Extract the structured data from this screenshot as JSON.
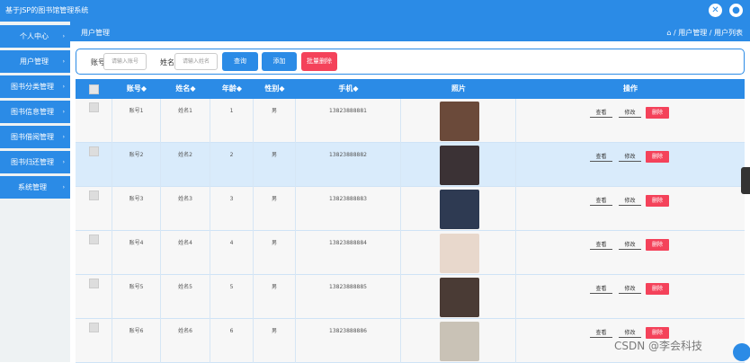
{
  "app": {
    "title": "基于JSP的图书馆管理系统",
    "header_icons": [
      "close-circle-icon",
      "user-icon"
    ]
  },
  "sidebar": {
    "items": [
      {
        "label": "个人中心"
      },
      {
        "label": "用户管理"
      },
      {
        "label": "图书分类管理"
      },
      {
        "label": "图书信息管理"
      },
      {
        "label": "图书借阅管理"
      },
      {
        "label": "图书归还管理"
      },
      {
        "label": "系统管理"
      }
    ]
  },
  "breadcrumb": {
    "title": "用户管理",
    "path": "⌂ / 用户管理 / 用户列表"
  },
  "search": {
    "account_label": "账号",
    "account_placeholder": "请输入账号",
    "name_label": "姓名",
    "name_placeholder": "请输入姓名",
    "query_label": "查询",
    "add_label": "添加",
    "batch_delete_label": "批量删除"
  },
  "table": {
    "headers": [
      "",
      "账号◆",
      "姓名◆",
      "年龄◆",
      "性别◆",
      "手机◆",
      "照片",
      "操作"
    ],
    "actions": {
      "view": "查看",
      "edit": "修改",
      "delete": "删除"
    },
    "rows": [
      {
        "account": "账号1",
        "name": "姓名1",
        "age": "1",
        "gender": "男",
        "phone": "13823888881"
      },
      {
        "account": "账号2",
        "name": "姓名2",
        "age": "2",
        "gender": "男",
        "phone": "13823888882"
      },
      {
        "account": "账号3",
        "name": "姓名3",
        "age": "3",
        "gender": "男",
        "phone": "13823888883"
      },
      {
        "account": "账号4",
        "name": "姓名4",
        "age": "4",
        "gender": "男",
        "phone": "13823888884"
      },
      {
        "account": "账号5",
        "name": "姓名5",
        "age": "5",
        "gender": "男",
        "phone": "13823888885"
      },
      {
        "account": "账号6",
        "name": "姓名6",
        "age": "6",
        "gender": "男",
        "phone": "13823888886"
      }
    ]
  },
  "watermark": "CSDN @李会科技",
  "colors": {
    "primary": "#2b8be6",
    "danger": "#f4425a",
    "row_hover": "#d9ebfb",
    "row_alt": "#f7f7f7"
  }
}
